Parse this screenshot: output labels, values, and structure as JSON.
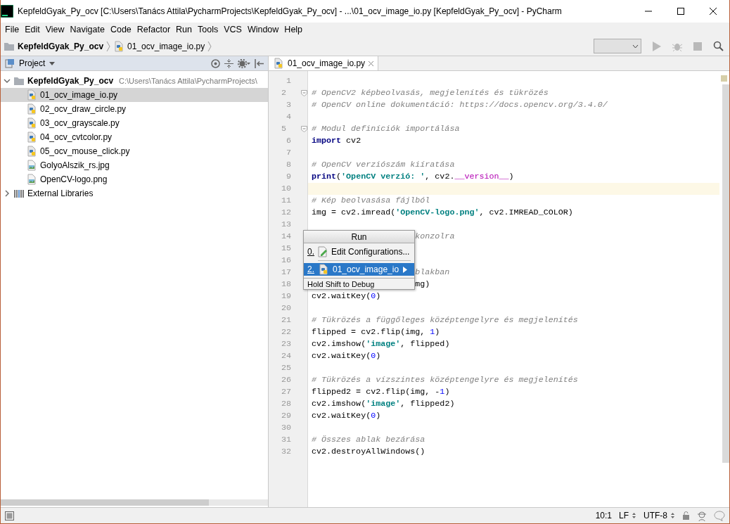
{
  "window": {
    "title": "KepfeldGyak_Py_ocv [C:\\Users\\Tanács Attila\\PycharmProjects\\KepfeldGyak_Py_ocv] - ...\\01_ocv_image_io.py [KepfeldGyak_Py_ocv] - PyCharm"
  },
  "menu": [
    "File",
    "Edit",
    "View",
    "Navigate",
    "Code",
    "Refactor",
    "Run",
    "Tools",
    "VCS",
    "Window",
    "Help"
  ],
  "breadcrumbs": [
    {
      "label": "KepfeldGyak_Py_ocv",
      "kind": "folder"
    },
    {
      "label": "01_ocv_image_io.py",
      "kind": "python"
    }
  ],
  "toolbar": {
    "run_disabled": true,
    "debug_disabled": true,
    "stop_disabled": true
  },
  "project_panel": {
    "title": "Project",
    "tree": [
      {
        "label": "KepfeldGyak_Py_ocv",
        "path": "C:\\Users\\Tanács Attila\\PycharmProjects\\",
        "kind": "folder",
        "expanded": true,
        "selected": false,
        "children": [
          {
            "label": "01_ocv_image_io.py",
            "kind": "python",
            "selected": true
          },
          {
            "label": "02_ocv_draw_circle.py",
            "kind": "python",
            "selected": false
          },
          {
            "label": "03_ocv_grayscale.py",
            "kind": "python",
            "selected": false
          },
          {
            "label": "04_ocv_cvtcolor.py",
            "kind": "python",
            "selected": false
          },
          {
            "label": "05_ocv_mouse_click.py",
            "kind": "python",
            "selected": false
          },
          {
            "label": "GolyoAlszik_rs.jpg",
            "kind": "image",
            "selected": false
          },
          {
            "label": "OpenCV-logo.png",
            "kind": "image",
            "selected": false
          }
        ]
      },
      {
        "label": "External Libraries",
        "kind": "library",
        "expanded": false,
        "selected": false
      }
    ]
  },
  "editor": {
    "tabs": [
      {
        "label": "01_ocv_image_io.py",
        "selected": true
      }
    ],
    "lines": [
      {
        "number": "1",
        "current": false
      },
      {
        "number": "2",
        "current": false,
        "fold": true,
        "tokens": [
          {
            "kind": "comment",
            "text": "# OpenCV2 képbeolvasás, megjelenítés és tükrözés"
          }
        ]
      },
      {
        "number": "3",
        "current": false,
        "tokens": [
          {
            "kind": "comment",
            "text": "# OpenCV online dokumentáció: https://docs.opencv.org/3.4.0/"
          }
        ]
      },
      {
        "number": "4",
        "current": false
      },
      {
        "number": "5",
        "current": false,
        "fold": true,
        "tokens": [
          {
            "kind": "comment",
            "text": "# Modul definíciók importálása"
          }
        ]
      },
      {
        "number": "6",
        "current": false,
        "tokens": [
          {
            "kind": "keyword",
            "text": "import"
          },
          {
            "kind": "plain",
            "text": " cv2"
          }
        ]
      },
      {
        "number": "7",
        "current": false
      },
      {
        "number": "8",
        "current": false,
        "tokens": [
          {
            "kind": "comment",
            "text": "# OpenCV verziószám kiíratása"
          }
        ]
      },
      {
        "number": "9",
        "current": false,
        "tokens": [
          {
            "kind": "keyword",
            "text": "print"
          },
          {
            "kind": "plain",
            "text": "("
          },
          {
            "kind": "string",
            "text": "'OpenCV verzió: '"
          },
          {
            "kind": "plain",
            "text": ", cv2."
          },
          {
            "kind": "magic",
            "text": "__version__"
          },
          {
            "kind": "plain",
            "text": ")"
          }
        ]
      },
      {
        "number": "10",
        "current": true
      },
      {
        "number": "11",
        "current": false,
        "tokens": [
          {
            "kind": "comment",
            "text": "# Kép beolvasása fájlból"
          }
        ]
      },
      {
        "number": "12",
        "current": false,
        "tokens": [
          {
            "kind": "plain",
            "text": "img = cv2.imread("
          },
          {
            "kind": "string",
            "text": "'OpenCV-logo.png'"
          },
          {
            "kind": "plain",
            "text": ", cv2.IMREAD_COLOR)"
          }
        ]
      },
      {
        "number": "13",
        "current": false
      },
      {
        "number": "14",
        "current": false,
        "covered": true,
        "tokens": [
          {
            "kind": "comment",
            "text": "konzolra"
          }
        ]
      },
      {
        "number": "15",
        "current": false
      },
      {
        "number": "16",
        "current": false
      },
      {
        "number": "17",
        "current": false,
        "covered": true,
        "tokens": [
          {
            "kind": "comment",
            "text": "blakban"
          }
        ]
      },
      {
        "number": "18",
        "current": false,
        "covered": true,
        "tokens": [
          {
            "kind": "plain",
            "text": "mg)"
          }
        ]
      },
      {
        "number": "19",
        "current": false,
        "tokens": [
          {
            "kind": "plain",
            "text": "cv2.waitKey("
          },
          {
            "kind": "number",
            "text": "0"
          },
          {
            "kind": "plain",
            "text": ")"
          }
        ]
      },
      {
        "number": "20",
        "current": false
      },
      {
        "number": "21",
        "current": false,
        "tokens": [
          {
            "kind": "comment",
            "text": "# Tükrözés a függőleges középtengelyre és megjelenítés"
          }
        ]
      },
      {
        "number": "22",
        "current": false,
        "tokens": [
          {
            "kind": "plain",
            "text": "flipped = cv2.flip(img, "
          },
          {
            "kind": "number",
            "text": "1"
          },
          {
            "kind": "plain",
            "text": ")"
          }
        ]
      },
      {
        "number": "23",
        "current": false,
        "tokens": [
          {
            "kind": "plain",
            "text": "cv2.imshow("
          },
          {
            "kind": "string",
            "text": "'image'"
          },
          {
            "kind": "plain",
            "text": ", flipped)"
          }
        ]
      },
      {
        "number": "24",
        "current": false,
        "tokens": [
          {
            "kind": "plain",
            "text": "cv2.waitKey("
          },
          {
            "kind": "number",
            "text": "0"
          },
          {
            "kind": "plain",
            "text": ")"
          }
        ]
      },
      {
        "number": "25",
        "current": false
      },
      {
        "number": "26",
        "current": false,
        "tokens": [
          {
            "kind": "comment",
            "text": "# Tükrözés a vízszintes középtengelyre és megjelenítés"
          }
        ]
      },
      {
        "number": "27",
        "current": false,
        "tokens": [
          {
            "kind": "plain",
            "text": "flipped2 = cv2.flip(img, -"
          },
          {
            "kind": "number",
            "text": "1"
          },
          {
            "kind": "plain",
            "text": ")"
          }
        ]
      },
      {
        "number": "28",
        "current": false,
        "tokens": [
          {
            "kind": "plain",
            "text": "cv2.imshow("
          },
          {
            "kind": "string",
            "text": "'image'"
          },
          {
            "kind": "plain",
            "text": ", flipped2)"
          }
        ]
      },
      {
        "number": "29",
        "current": false,
        "tokens": [
          {
            "kind": "plain",
            "text": "cv2.waitKey("
          },
          {
            "kind": "number",
            "text": "0"
          },
          {
            "kind": "plain",
            "text": ")"
          }
        ]
      },
      {
        "number": "30",
        "current": false
      },
      {
        "number": "31",
        "current": false,
        "tokens": [
          {
            "kind": "comment",
            "text": "# Összes ablak bezárása"
          }
        ]
      },
      {
        "number": "32",
        "current": false,
        "tokens": [
          {
            "kind": "plain",
            "text": "cv2.destroyAllWindows()"
          }
        ]
      }
    ]
  },
  "popup": {
    "title": "Run",
    "items": [
      {
        "mnemonic": "0.",
        "label": "Edit Configurations...",
        "kind": "edit",
        "selected": false,
        "submenu": false
      },
      {
        "mnemonic": "2.",
        "label": "01_ocv_image_io",
        "kind": "python",
        "selected": true,
        "submenu": true
      }
    ],
    "footer": "Hold Shift to Debug"
  },
  "status_bar": {
    "position": "10:1",
    "line_separator": "LF",
    "encoding": "UTF-8"
  }
}
